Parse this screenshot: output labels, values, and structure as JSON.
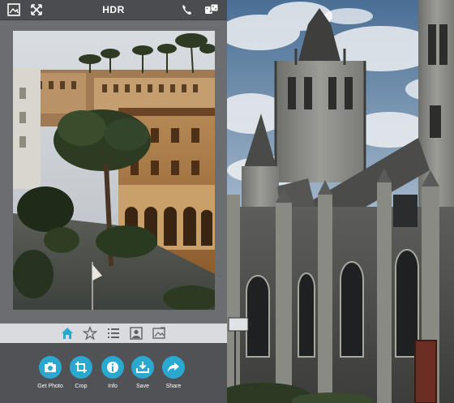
{
  "app": {
    "title": "HDR",
    "top_icons": [
      "picture-frame-icon",
      "expand-arrows-icon",
      "phone-icon",
      "dice-icon"
    ],
    "tabs": [
      {
        "name": "home-icon",
        "active": true
      },
      {
        "name": "star-icon",
        "active": false
      },
      {
        "name": "list-icon",
        "active": false
      },
      {
        "name": "portrait-icon",
        "active": false
      },
      {
        "name": "picture-edit-icon",
        "active": false
      }
    ],
    "actions": {
      "get_photo": "Get Photo",
      "crop": "Crop",
      "info": "Info",
      "save": "Save",
      "share": "Share"
    },
    "colors": {
      "accent": "#2aa8cf",
      "topbar": "#4a4c4f",
      "tabbar": "#d9dbde",
      "active_tab": "#2aa8cf",
      "inactive_tab": "#5e6063"
    }
  }
}
